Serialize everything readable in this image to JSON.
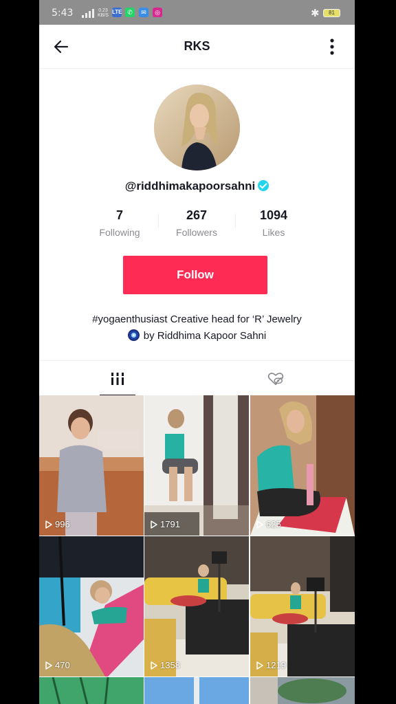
{
  "status_bar": {
    "time": "5:43",
    "network_speed": "0.23 KB/S",
    "network_type": "LTE",
    "battery": "81"
  },
  "header": {
    "title": "RKS"
  },
  "profile": {
    "username": "@riddhimakapoorsahni",
    "verified": true,
    "stats": [
      {
        "value": "7",
        "label": "Following"
      },
      {
        "value": "267",
        "label": "Followers"
      },
      {
        "value": "1094",
        "label": "Likes"
      }
    ],
    "follow_label": "Follow",
    "bio_line1": "#yogaenthusiast Creative head for ‘R’ Jewelry",
    "bio_line2": "by Riddhima Kapoor Sahni"
  },
  "tabs": [
    {
      "icon": "videos-grid-icon",
      "selected": true
    },
    {
      "icon": "liked-hidden-icon",
      "selected": false
    }
  ],
  "videos": [
    {
      "views": "996"
    },
    {
      "views": "1791"
    },
    {
      "views": "625"
    },
    {
      "views": "470"
    },
    {
      "views": "1358"
    },
    {
      "views": "1219"
    }
  ],
  "colors": {
    "accent": "#fe2c55",
    "verified": "#20d5ec",
    "status_bar": "#8e8e8e"
  }
}
